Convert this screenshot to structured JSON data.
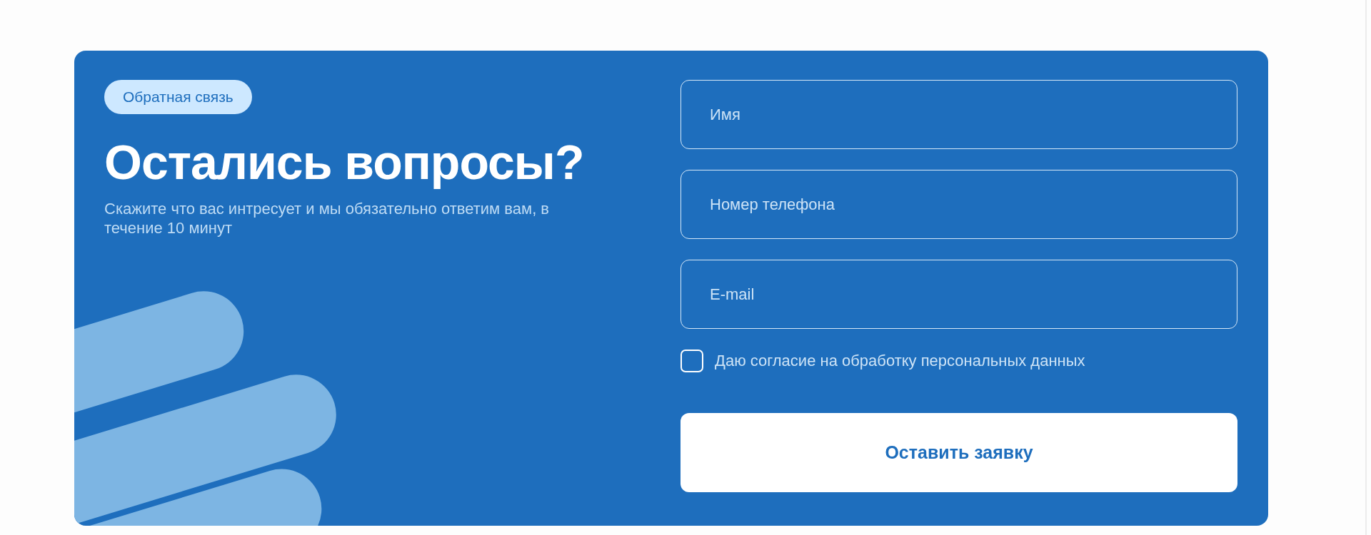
{
  "badge": "Обратная связь",
  "title": "Остались вопросы?",
  "subtitle": "Скажите что вас интресует и мы обязательно ответим вам, в течение 10 минут",
  "fields": [
    {
      "placeholder": "Имя"
    },
    {
      "placeholder": "Номер телефона"
    },
    {
      "placeholder": "E-mail"
    }
  ],
  "consent": {
    "label": "Даю согласие на обработку персональных данных",
    "checked": false
  },
  "submit": "Оставить заявку"
}
